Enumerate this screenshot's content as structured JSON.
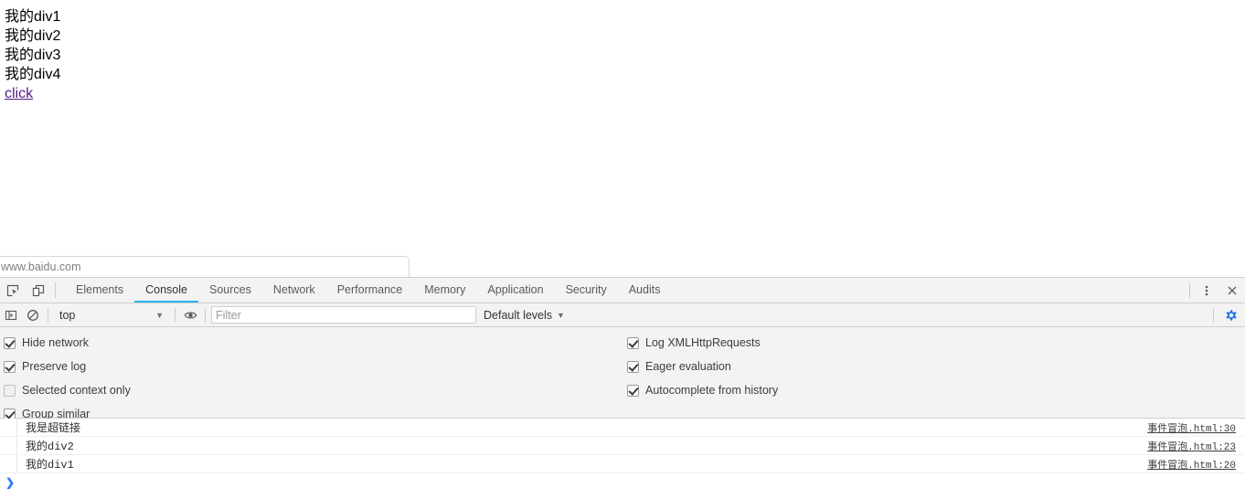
{
  "page": {
    "divs": [
      {
        "text": "我的div1"
      },
      {
        "text": "我的div2"
      },
      {
        "text": "我的div3"
      },
      {
        "text": "我的div4"
      }
    ],
    "link_label": "click"
  },
  "status_bubble": {
    "url": "www.baidu.com"
  },
  "devtools": {
    "tabbar": {
      "inspect_icon": "inspect-element-icon",
      "device_icon": "device-toolbar-icon",
      "tabs": [
        {
          "label": "Elements",
          "active": false
        },
        {
          "label": "Console",
          "active": true
        },
        {
          "label": "Sources",
          "active": false
        },
        {
          "label": "Network",
          "active": false
        },
        {
          "label": "Performance",
          "active": false
        },
        {
          "label": "Memory",
          "active": false
        },
        {
          "label": "Application",
          "active": false
        },
        {
          "label": "Security",
          "active": false
        },
        {
          "label": "Audits",
          "active": false
        }
      ],
      "more_icon": "more-options-icon",
      "close_icon": "close-icon"
    },
    "filterbar": {
      "sidebar_icon": "console-sidebar-icon",
      "clear_icon": "clear-console-icon",
      "context_value": "top",
      "eye_icon": "live-expression-icon",
      "filter_placeholder": "Filter",
      "filter_value": "",
      "levels_label": "Default levels",
      "gear_icon": "settings-gear-icon",
      "gear_color": "#1a73e8"
    },
    "settings": {
      "left_column": [
        {
          "label": "Hide network",
          "checked": true
        },
        {
          "label": "Preserve log",
          "checked": true
        },
        {
          "label": "Selected context only",
          "checked": false
        },
        {
          "label": "Group similar",
          "checked": true
        }
      ],
      "right_column": [
        {
          "label": "Log XMLHttpRequests",
          "checked": true
        },
        {
          "label": "Eager evaluation",
          "checked": true
        },
        {
          "label": "Autocomplete from history",
          "checked": true
        }
      ]
    },
    "messages": [
      {
        "text": "我是超链接",
        "source": "事件冒泡.html:30"
      },
      {
        "text": "我的div2",
        "source": "事件冒泡.html:23"
      },
      {
        "text": "我的div1",
        "source": "事件冒泡.html:20"
      }
    ],
    "prompt": {
      "marker": "❯",
      "value": ""
    }
  },
  "colors": {
    "active_tab_underline": "#29b6f6",
    "visited_link": "#551a8b",
    "gear_active": "#1a73e8",
    "panel_bg": "#f3f3f3"
  }
}
